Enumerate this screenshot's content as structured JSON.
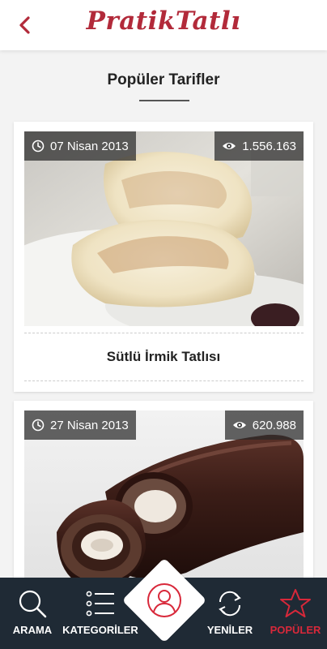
{
  "header": {
    "logo_text": "PratikTatlı",
    "back_icon": "chevron-left-icon",
    "brand_color": "#b22a3a"
  },
  "section": {
    "title": "Popüler Tarifler"
  },
  "recipes": [
    {
      "date": "07 Nisan 2013",
      "views": "1.556.163",
      "name": "Sütlü İrmik Tatlısı"
    },
    {
      "date": "27 Nisan 2013",
      "views": "620.988",
      "name": ""
    }
  ],
  "nav": {
    "items": [
      {
        "label": "ARAMA",
        "icon": "search-icon"
      },
      {
        "label": "KATEGORİLER",
        "icon": "list-icon"
      },
      {
        "label": "",
        "icon": "user-icon"
      },
      {
        "label": "YENİLER",
        "icon": "refresh-icon"
      },
      {
        "label": "POPÜLER",
        "icon": "star-icon"
      }
    ],
    "active_color": "#d8283a",
    "background": "#1f2a35"
  }
}
